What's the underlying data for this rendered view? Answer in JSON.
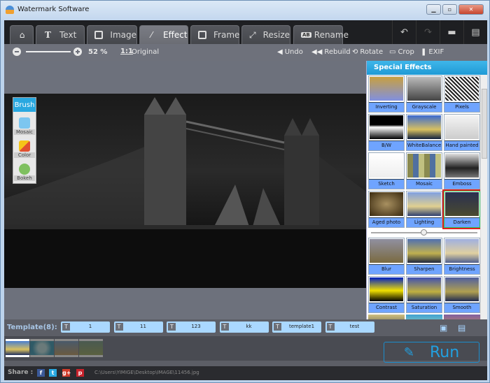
{
  "window": {
    "title": "Watermark Software"
  },
  "tabs": [
    {
      "label": "",
      "icon": "home-icon"
    },
    {
      "label": "Text",
      "icon": "text-icon"
    },
    {
      "label": "Image",
      "icon": "image-icon"
    },
    {
      "label": "Effect",
      "icon": "magic-wand-icon",
      "active": true
    },
    {
      "label": "Frame",
      "icon": "frame-icon"
    },
    {
      "label": "Resize",
      "icon": "resize-icon"
    },
    {
      "label": "Rename",
      "icon": "rename-icon"
    }
  ],
  "toolbar": {
    "zoom_percent": "52 %",
    "zoom_level": 52,
    "one_to_one": "1:1",
    "original": "Original",
    "undo": "Undo",
    "rebuild": "Rebuild",
    "rotate": "Rotate",
    "crop": "Crop",
    "exif": "EXIF"
  },
  "brush": {
    "title": "Brush",
    "items": [
      "Mosaic",
      "Color",
      "Bokeh"
    ]
  },
  "effects": {
    "title": "Special Effects",
    "items": [
      "Inverting",
      "Grayscale",
      "Pixels",
      "B/W",
      "WhiteBalance",
      "Hand painted",
      "Sketch",
      "Mosaic",
      "Emboss",
      "Aged photo",
      "Lighting",
      "Darken",
      "Blur",
      "Sharpen",
      "Brightness",
      "Contrast",
      "Saturation",
      "Smooth"
    ],
    "selected": "Darken",
    "intensity": 0.5
  },
  "templates": {
    "label": "Template(8):",
    "items": [
      "1",
      "11",
      "123",
      "kk",
      "template1",
      "test"
    ]
  },
  "run_label": "Run",
  "share": {
    "label": "Share :",
    "path": "C:\\Users\\YIMIGE\\Desktop\\IMAGE\\11456.jpg"
  },
  "colors": {
    "accent": "#29a8e0",
    "effect_label": "#6fa4ff",
    "selected_border": "#e02020"
  }
}
